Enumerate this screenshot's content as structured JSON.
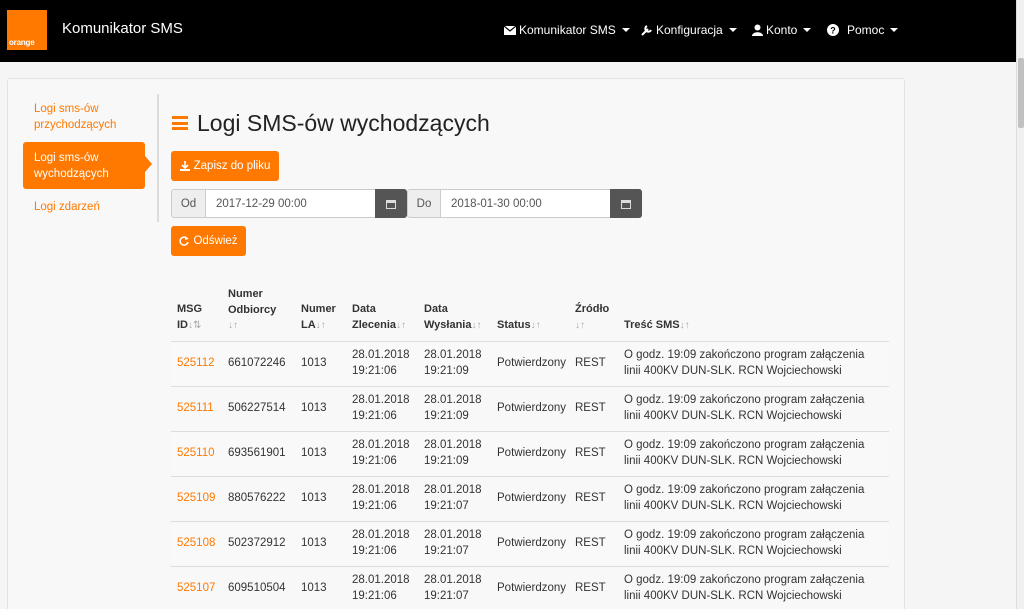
{
  "app": {
    "logo_text": "orange",
    "brand": "Komunikator SMS",
    "brand_color": "#ff7900"
  },
  "nav": {
    "items": [
      {
        "label": "Komunikator SMS",
        "icon": "envelope-icon"
      },
      {
        "label": "Konfiguracja",
        "icon": "wrench-icon"
      },
      {
        "label": "Konto",
        "icon": "user-icon"
      },
      {
        "label": "Pomoc",
        "icon": "question-circle-icon"
      }
    ]
  },
  "sidebar": {
    "items": [
      {
        "label": "Logi sms-ów przychodzących",
        "active": false
      },
      {
        "label": "Logi sms-ów wychodzących",
        "active": true
      },
      {
        "label": "Logi zdarzeń",
        "active": false
      }
    ]
  },
  "main": {
    "title": "Logi SMS-ów wychodzących",
    "export_label": "Zapisz do pliku",
    "from_label": "Od",
    "from_value": "2017-12-29 00:00",
    "to_label": "Do",
    "to_value": "2018-01-30 00:00",
    "refresh_label": "Odśwież"
  },
  "table": {
    "headers": [
      {
        "line1": "MSG",
        "line2": "ID"
      },
      {
        "line0": "Numer",
        "line1": "Odbiorcy",
        "line2": ""
      },
      {
        "line1": "Numer",
        "line2": "LA"
      },
      {
        "line1": "Data",
        "line2": "Zlecenia"
      },
      {
        "line1": "Data",
        "line2": "Wysłania"
      },
      {
        "line1": "",
        "line2": "Status"
      },
      {
        "line1": "Źródło",
        "line2": ""
      },
      {
        "line1": "",
        "line2": "Treść SMS"
      }
    ],
    "rows": [
      {
        "id": "525112",
        "recipient": "661072246",
        "la": "1013",
        "ordered_date": "28.01.2018",
        "ordered_time": "19:21:06",
        "sent_date": "28.01.2018",
        "sent_time": "19:21:09",
        "status": "Potwierdzony",
        "source": "REST",
        "text1": "O godz. 19:09 zakończono program załączenia",
        "text2": "linii 400KV DUN-SLK. RCN Wojciechowski"
      },
      {
        "id": "525111",
        "recipient": "506227514",
        "la": "1013",
        "ordered_date": "28.01.2018",
        "ordered_time": "19:21:06",
        "sent_date": "28.01.2018",
        "sent_time": "19:21:09",
        "status": "Potwierdzony",
        "source": "REST",
        "text1": "O godz. 19:09 zakończono program załączenia",
        "text2": "linii 400KV DUN-SLK. RCN Wojciechowski"
      },
      {
        "id": "525110",
        "recipient": "693561901",
        "la": "1013",
        "ordered_date": "28.01.2018",
        "ordered_time": "19:21:06",
        "sent_date": "28.01.2018",
        "sent_time": "19:21:09",
        "status": "Potwierdzony",
        "source": "REST",
        "text1": "O godz. 19:09 zakończono program załączenia",
        "text2": "linii 400KV DUN-SLK. RCN Wojciechowski"
      },
      {
        "id": "525109",
        "recipient": "880576222",
        "la": "1013",
        "ordered_date": "28.01.2018",
        "ordered_time": "19:21:06",
        "sent_date": "28.01.2018",
        "sent_time": "19:21:07",
        "status": "Potwierdzony",
        "source": "REST",
        "text1": "O godz. 19:09 zakończono program załączenia",
        "text2": "linii 400KV DUN-SLK. RCN Wojciechowski"
      },
      {
        "id": "525108",
        "recipient": "502372912",
        "la": "1013",
        "ordered_date": "28.01.2018",
        "ordered_time": "19:21:06",
        "sent_date": "28.01.2018",
        "sent_time": "19:21:07",
        "status": "Potwierdzony",
        "source": "REST",
        "text1": "O godz. 19:09 zakończono program załączenia",
        "text2": "linii 400KV DUN-SLK. RCN Wojciechowski"
      },
      {
        "id": "525107",
        "recipient": "609510504",
        "la": "1013",
        "ordered_date": "28.01.2018",
        "ordered_time": "19:21:06",
        "sent_date": "28.01.2018",
        "sent_time": "19:21:07",
        "status": "Potwierdzony",
        "source": "REST",
        "text1": "O godz. 19:09 zakończono program załączenia",
        "text2": "linii 400KV DUN-SLK. RCN Wojciechowski"
      }
    ]
  }
}
